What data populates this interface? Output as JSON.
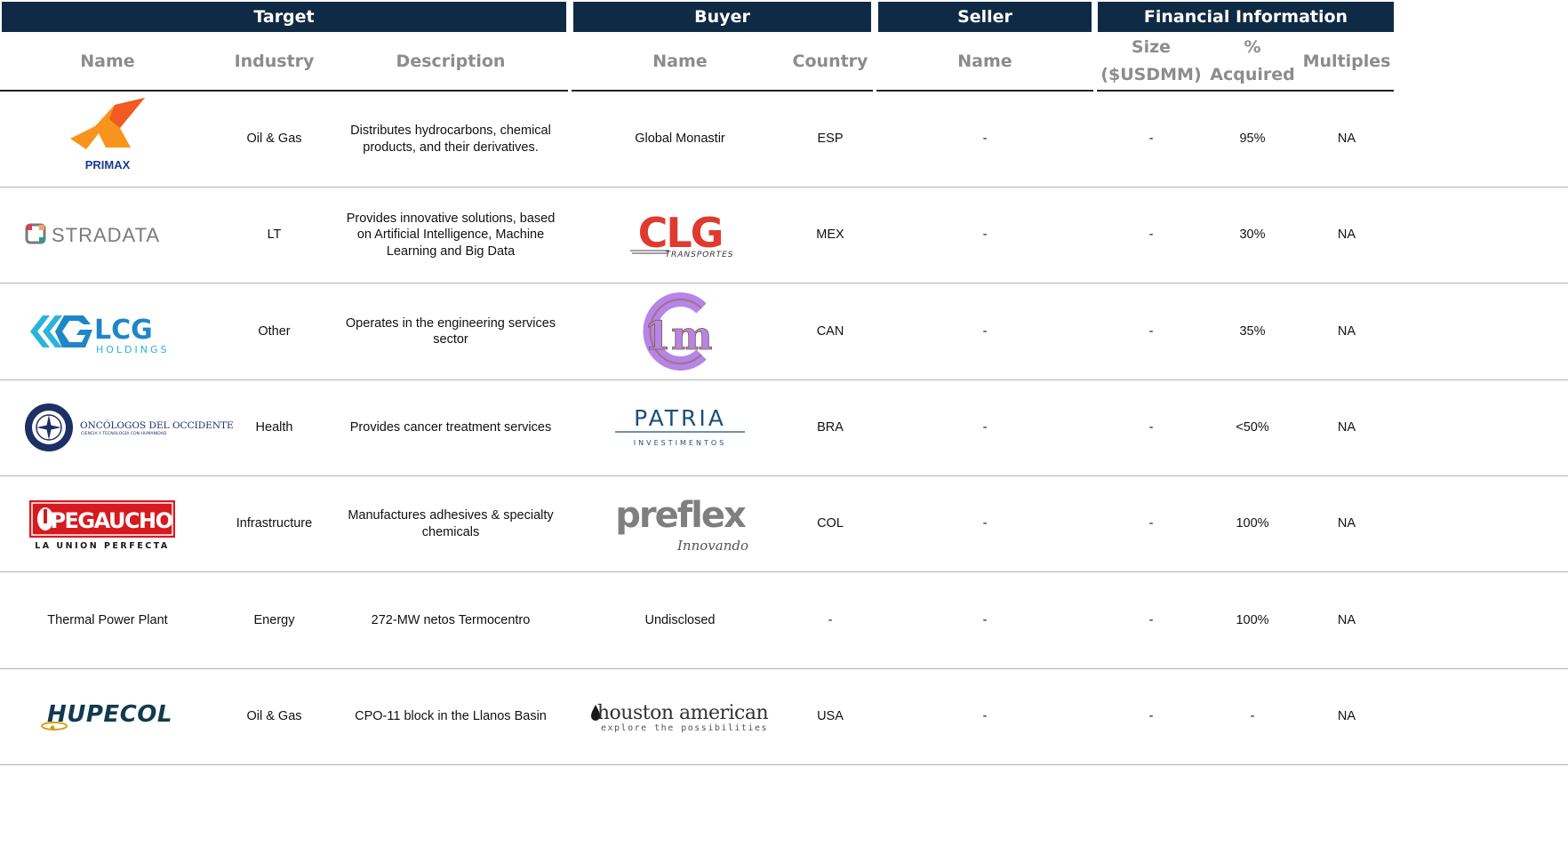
{
  "groups": {
    "target": "Target",
    "buyer": "Buyer",
    "seller": "Seller",
    "financial": "Financial Information"
  },
  "columns": {
    "target_name": "Name",
    "industry": "Industry",
    "description": "Description",
    "buyer_name": "Name",
    "country": "Country",
    "seller_name": "Name",
    "size": "Size ($USDMM)",
    "acquired": "% Acquired",
    "multiples": "Multiples"
  },
  "rows": [
    {
      "target": "PRIMAX",
      "target_logo": "primax-logo",
      "industry": "Oil & Gas",
      "description": "Distributes hydrocarbons, chemical products, and their derivatives.",
      "buyer": "Global Monastir",
      "country": "ESP",
      "seller": "-",
      "size": "-",
      "acquired": "95%",
      "multiples": "NA"
    },
    {
      "target": "STRADATA",
      "target_logo": "stradata-logo",
      "industry": "LT",
      "description": "Provides innovative solutions, based on Artificial Intelligence, Machine Learning and Big Data",
      "buyer": "CLG",
      "buyer_sub": "TRANSPORTES",
      "buyer_logo": "clg-logo",
      "country": "MEX",
      "seller": "-",
      "size": "-",
      "acquired": "30%",
      "multiples": "NA"
    },
    {
      "target": "LCG",
      "target_sub": "HOLDINGS",
      "target_logo": "lcg-holdings-logo",
      "industry": "Other",
      "description": "Operates in the engineering services sector",
      "buyer": "1m",
      "buyer_logo": "c1m-logo",
      "country": "CAN",
      "seller": "-",
      "size": "-",
      "acquired": "35%",
      "multiples": "NA"
    },
    {
      "target": "ONCÓLOGOS DEL OCCIDENTE",
      "target_sub": "CIENCIA Y TECNOLOGÍA CON HUMANIDAD",
      "target_logo": "oncologos-logo",
      "industry": "Health",
      "description": "Provides cancer treatment services",
      "buyer": "PATRIA",
      "buyer_sub": "INVESTIMENTOS",
      "buyer_logo": "patria-logo",
      "country": "BRA",
      "seller": "-",
      "size": "-",
      "acquired": "<50%",
      "multiples": "NA"
    },
    {
      "target": "PEGAUCHO",
      "target_sub": "LA UNION PERFECTA",
      "target_logo": "pegaucho-logo",
      "industry": "Infrastructure",
      "description": "Manufactures adhesives & specialty chemicals",
      "buyer": "preflex",
      "buyer_sub": "Innovando",
      "buyer_logo": "preflex-logo",
      "country": "COL",
      "seller": "-",
      "size": "-",
      "acquired": "100%",
      "multiples": "NA"
    },
    {
      "target": "Thermal Power Plant",
      "industry": "Energy",
      "description": "272-MW netos Termocentro",
      "buyer": "Undisclosed",
      "country": "-",
      "seller": "-",
      "size": "-",
      "acquired": "100%",
      "multiples": "NA"
    },
    {
      "target": "HUPECOL",
      "target_logo": "hupecol-logo",
      "industry": "Oil & Gas",
      "description": "CPO-11 block in the Llanos Basin",
      "buyer": "houston american",
      "buyer_sub": "explore the possibilities",
      "buyer_logo": "houston-american-logo",
      "country": "USA",
      "seller": "-",
      "size": "-",
      "acquired": "-",
      "multiples": "NA"
    }
  ],
  "colors": {
    "header_bg": "#0f2a44",
    "header_text": "#ffffff",
    "column_header_text": "#8c8c8c"
  }
}
